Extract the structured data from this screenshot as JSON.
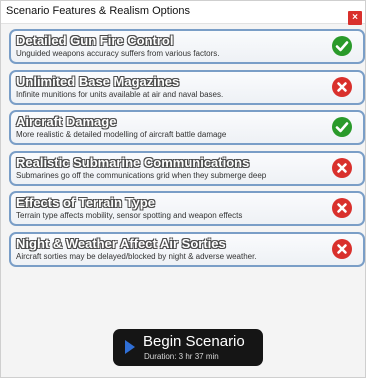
{
  "window": {
    "title": "Scenario Features & Realism Options",
    "close_label": "×"
  },
  "options": [
    {
      "title": "Detailed Gun Fire Control",
      "description": "Unguided weapons accuracy suffers from various factors.",
      "enabled": true,
      "status_icon": "check-icon"
    },
    {
      "title": "Unlimited Base Magazines",
      "description": "Infinite munitions for units available at air and naval bases.",
      "enabled": false,
      "status_icon": "x-icon"
    },
    {
      "title": "Aircraft Damage",
      "description": "More realistic & detailed modelling of aircraft battle damage",
      "enabled": true,
      "status_icon": "check-icon"
    },
    {
      "title": "Realistic Submarine Communications",
      "description": "Submarines go off the communications grid when they submerge deep",
      "enabled": false,
      "status_icon": "x-icon"
    },
    {
      "title": "Effects of Terrain Type",
      "description": "Terrain type affects mobility, sensor spotting and weapon effects",
      "enabled": false,
      "status_icon": "x-icon"
    },
    {
      "title": "Night & Weather Affect Air Sorties",
      "description": "Aircraft sorties may be delayed/blocked by night & adverse weather.",
      "enabled": false,
      "status_icon": "x-icon"
    }
  ],
  "begin": {
    "label": "Begin Scenario",
    "duration": "Duration: 3 hr 37 min",
    "icon": "play-icon"
  },
  "colors": {
    "enabled": "#2a9a2a",
    "disabled": "#d9302c",
    "card_border": "#7a9ec7",
    "button_bg": "#151515",
    "play_accent": "#2f6fd6"
  }
}
